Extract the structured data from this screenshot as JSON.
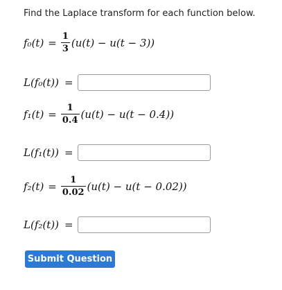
{
  "prompt": "Find the Laplace transform for each function below.",
  "functions": [
    {
      "lhs": "f₀(t)",
      "eq": "=",
      "num": "1",
      "den": "3",
      "rest": "(u(t) − u(t − 3))"
    },
    {
      "lhs": "f₁(t)",
      "eq": "=",
      "num": "1",
      "den": "0.4",
      "rest": "(u(t) − u(t − 0.4))"
    },
    {
      "lhs": "f₂(t)",
      "eq": "=",
      "num": "1",
      "den": "0.02",
      "rest": "(u(t) − u(t − 0.02))"
    }
  ],
  "answers": [
    {
      "label": "L(f₀(t))",
      "eq": "=",
      "value": ""
    },
    {
      "label": "L(f₁(t))",
      "eq": "=",
      "value": ""
    },
    {
      "label": "L(f₂(t))",
      "eq": "=",
      "value": ""
    }
  ],
  "submit_label": "Submit Question",
  "colors": {
    "accent": "#2c7ad6",
    "input_border": "#9a9a9a"
  }
}
